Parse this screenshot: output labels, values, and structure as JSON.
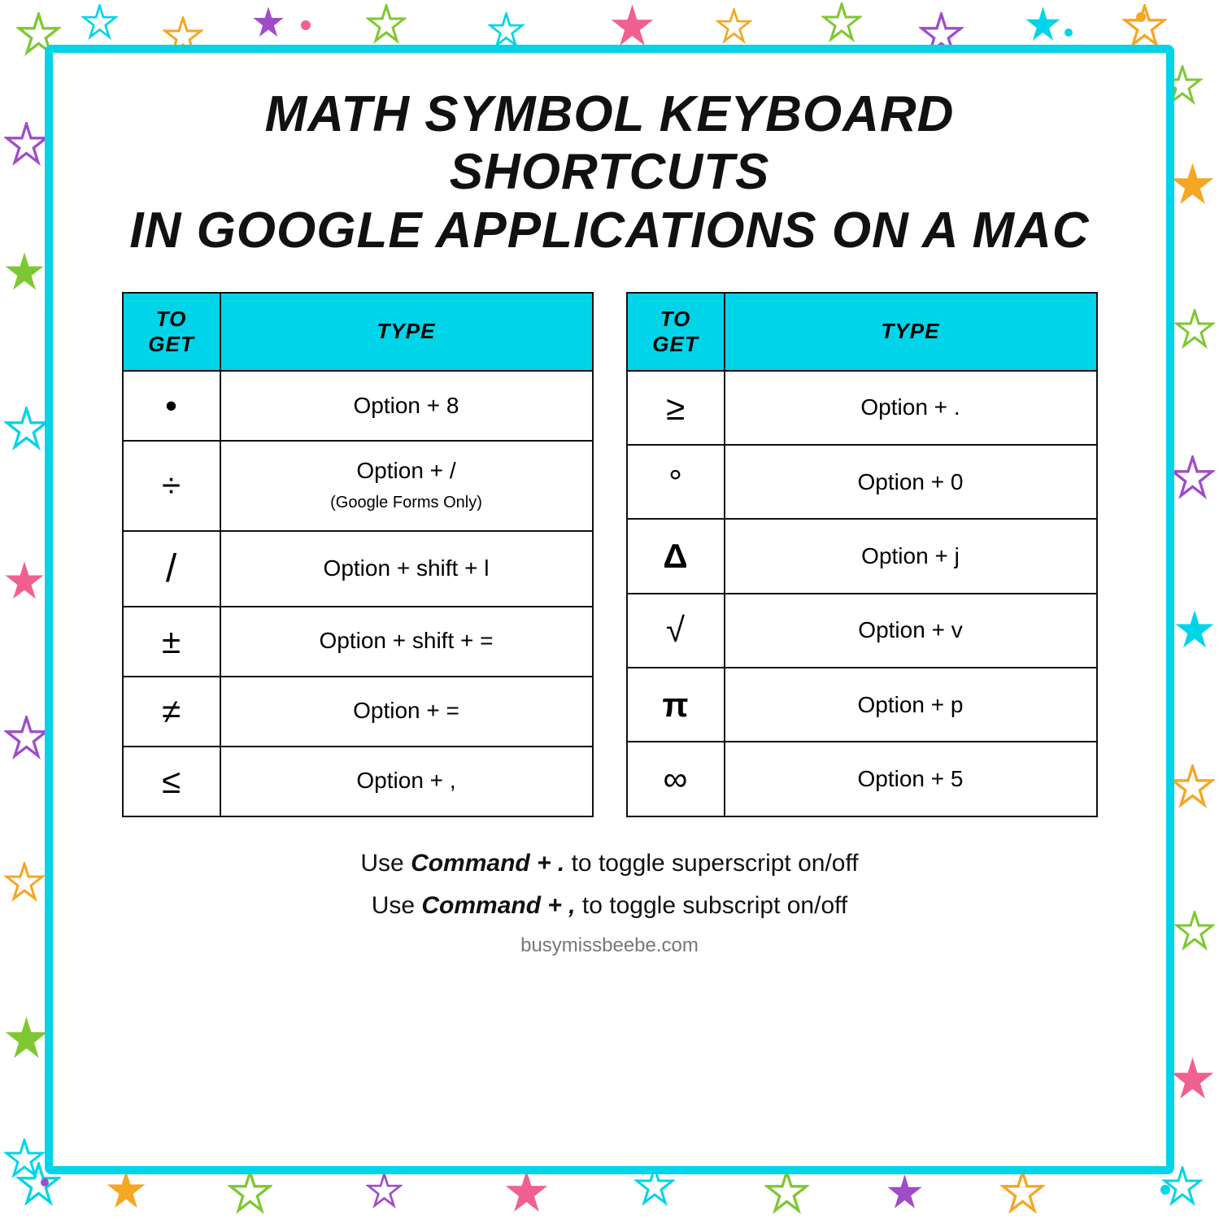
{
  "page": {
    "title_line1": "MATH SYMBOL KEYBOARD SHORTCUTS",
    "title_line2": "IN GOOGLE APPLICATIONS ON A MAC",
    "table_left": {
      "headers": [
        "TO GET",
        "TYPE"
      ],
      "rows": [
        {
          "symbol": "•",
          "type": "Option + 8"
        },
        {
          "symbol": "÷",
          "type": "Option + /\n(Google Forms Only)"
        },
        {
          "symbol": "/",
          "type": "Option + shift + l"
        },
        {
          "symbol": "±",
          "type": "Option + shift + ="
        },
        {
          "symbol": "≠",
          "type": "Option + ="
        },
        {
          "symbol": "≤",
          "type": "Option + ,"
        }
      ]
    },
    "table_right": {
      "headers": [
        "TO GET",
        "TYPE"
      ],
      "rows": [
        {
          "symbol": "≥",
          "type": "Option + ."
        },
        {
          "symbol": "°",
          "type": "Option + 0"
        },
        {
          "symbol": "Δ",
          "type": "Option + j"
        },
        {
          "symbol": "√",
          "type": "Option + v"
        },
        {
          "symbol": "π",
          "type": "Option + p"
        },
        {
          "symbol": "∞",
          "type": "Option + 5"
        }
      ]
    },
    "note1": "Use Command + . to toggle superscript on/off",
    "note1_bold": "Command + .",
    "note2": "Use Command + , to toggle subscript on/off",
    "note2_bold": "Command + ,",
    "website": "busymissbeebe.com"
  }
}
